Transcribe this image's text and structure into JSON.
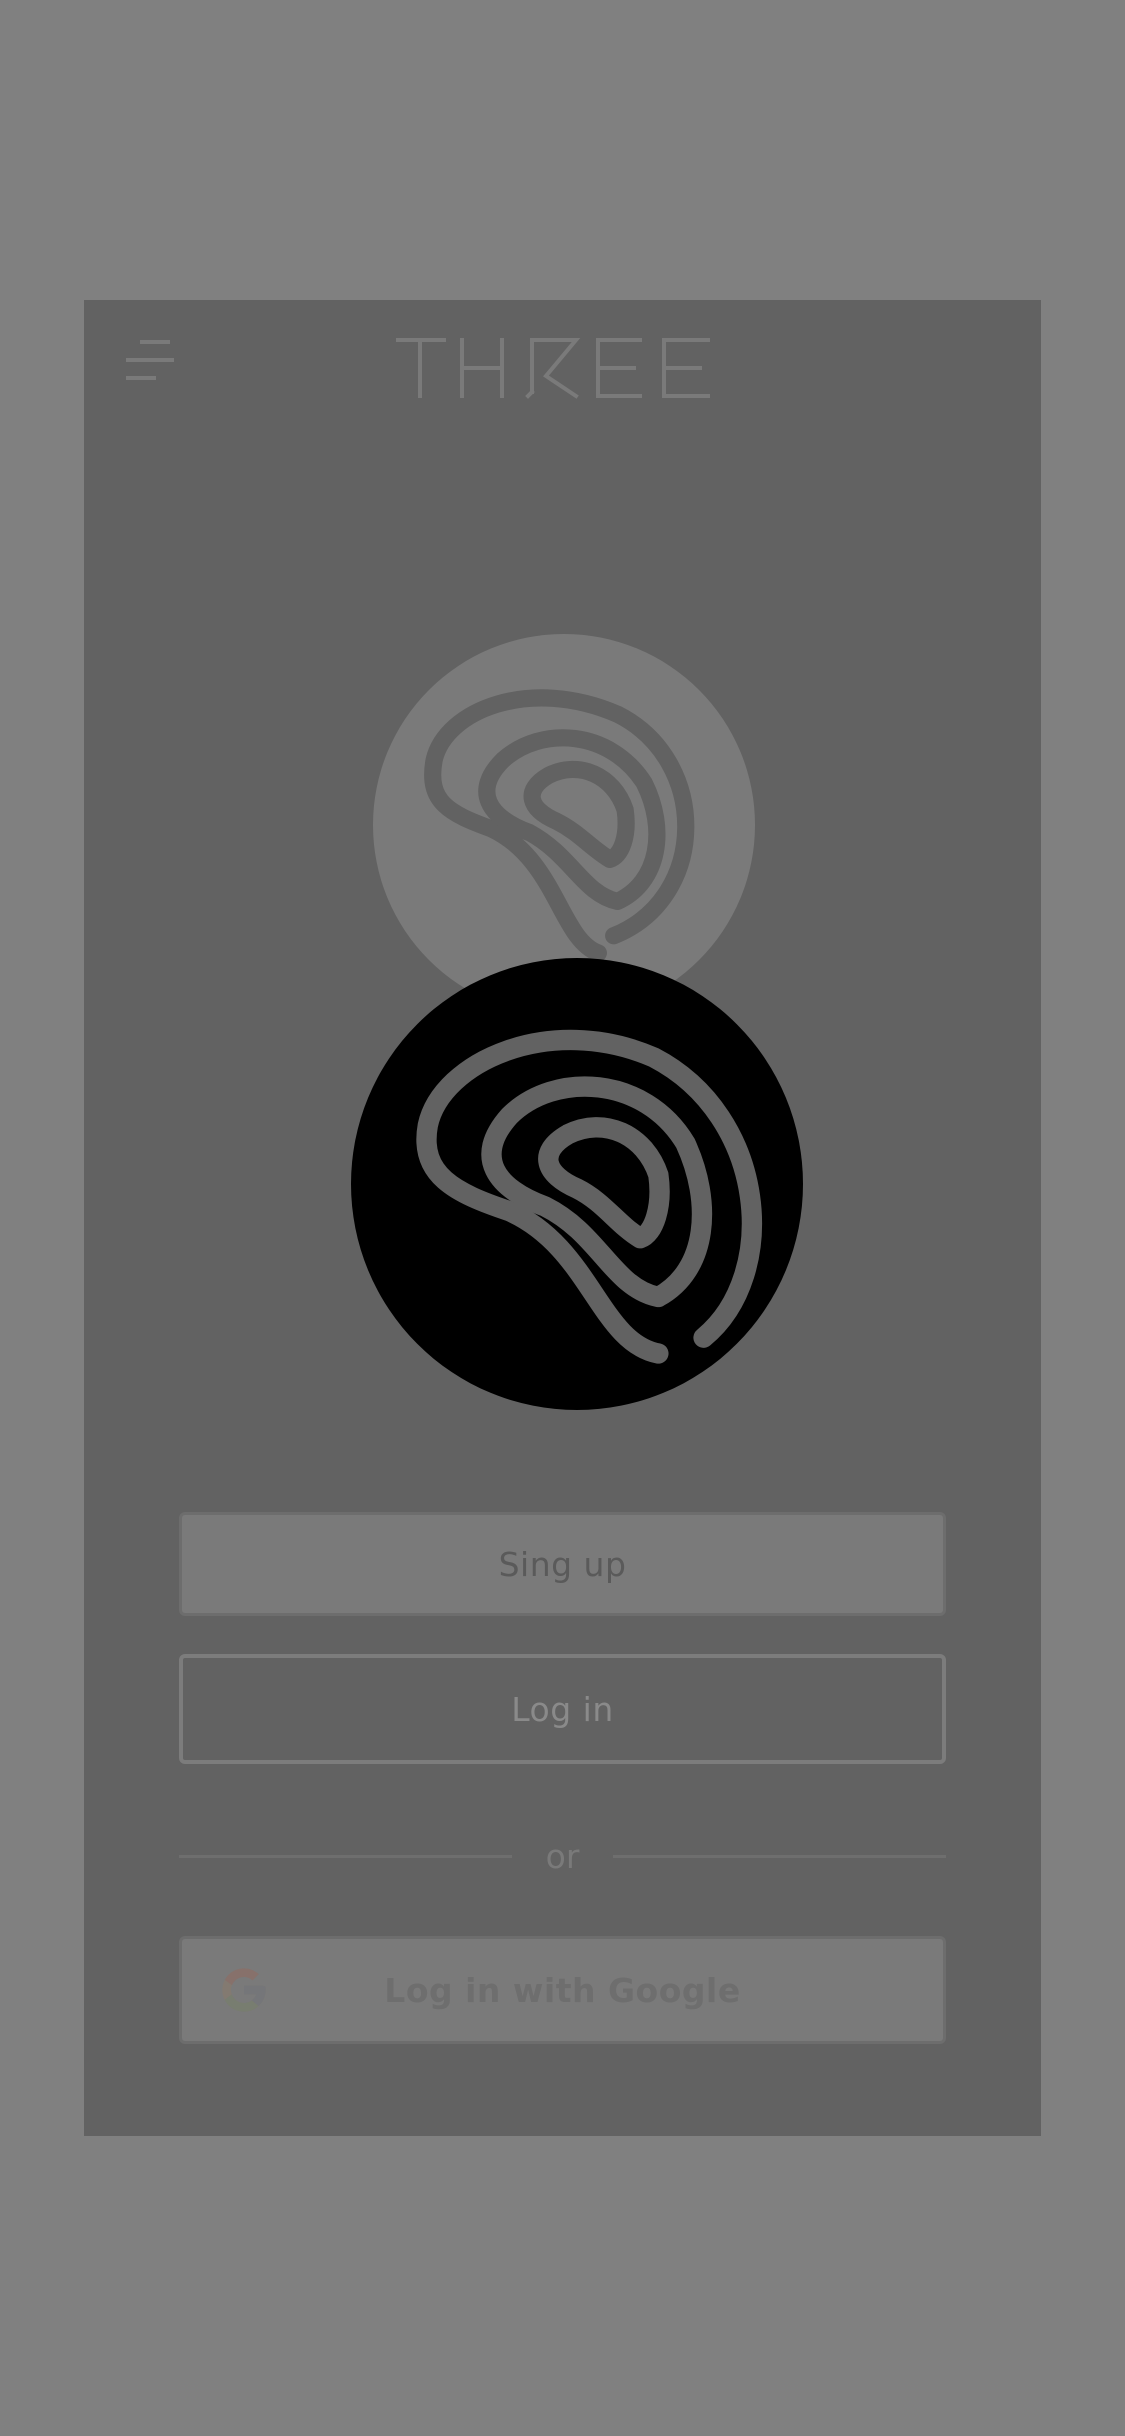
{
  "brand": {
    "wordmark": "THREE",
    "wordmark_color": "#7a7a7a"
  },
  "menu": {
    "icon": "hamburger-menu-icon"
  },
  "logo": {
    "icon": "spiral-swirl-logo-icon",
    "main_color": "#000000",
    "faded_color": "#7a7a7a"
  },
  "actions": {
    "signup_label": "Sing up",
    "login_label": "Log in",
    "divider_text": "or",
    "google_label": "Log in with Google",
    "google_icon": "google-g-icon"
  },
  "colors": {
    "backdrop": "#808080",
    "card": "#626262"
  }
}
